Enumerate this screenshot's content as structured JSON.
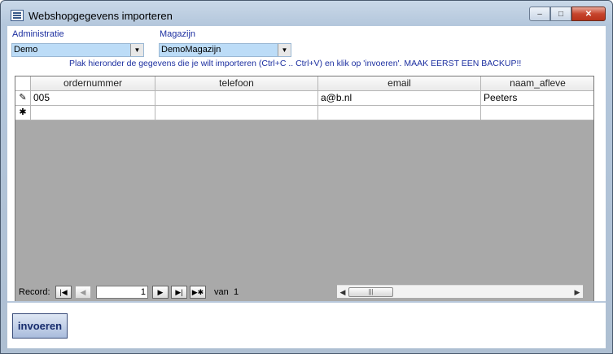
{
  "window": {
    "title": "Webshopgegevens importeren",
    "minimize_glyph": "–",
    "maximize_glyph": "□",
    "close_glyph": "✕"
  },
  "filters": {
    "administratie_label": "Administratie",
    "administratie_value": "Demo",
    "magazijn_label": "Magazijn",
    "magazijn_value": "DemoMagazijn"
  },
  "instruction": "Plak hieronder de gegevens die je wilt importeren (Ctrl+C .. Ctrl+V) en klik op 'invoeren'. MAAK EERST EEN BACKUP!!",
  "datasheet": {
    "columns": [
      "ordernummer",
      "telefoon",
      "email",
      "naam_afleve"
    ],
    "rows": [
      {
        "selector": "✎",
        "cells": [
          "005",
          "",
          "a@b.nl",
          "Peeters"
        ]
      },
      {
        "selector": "✱",
        "cells": [
          "",
          "",
          "",
          ""
        ]
      }
    ]
  },
  "record_nav": {
    "label": "Record:",
    "current": "1",
    "of_label": "van",
    "total": "1"
  },
  "actions": {
    "submit_label": "invoeren"
  },
  "colors": {
    "label_blue": "#1c2fa0",
    "combo_bg": "#bcdcf7",
    "sheet_bg": "#a9a9a9"
  }
}
